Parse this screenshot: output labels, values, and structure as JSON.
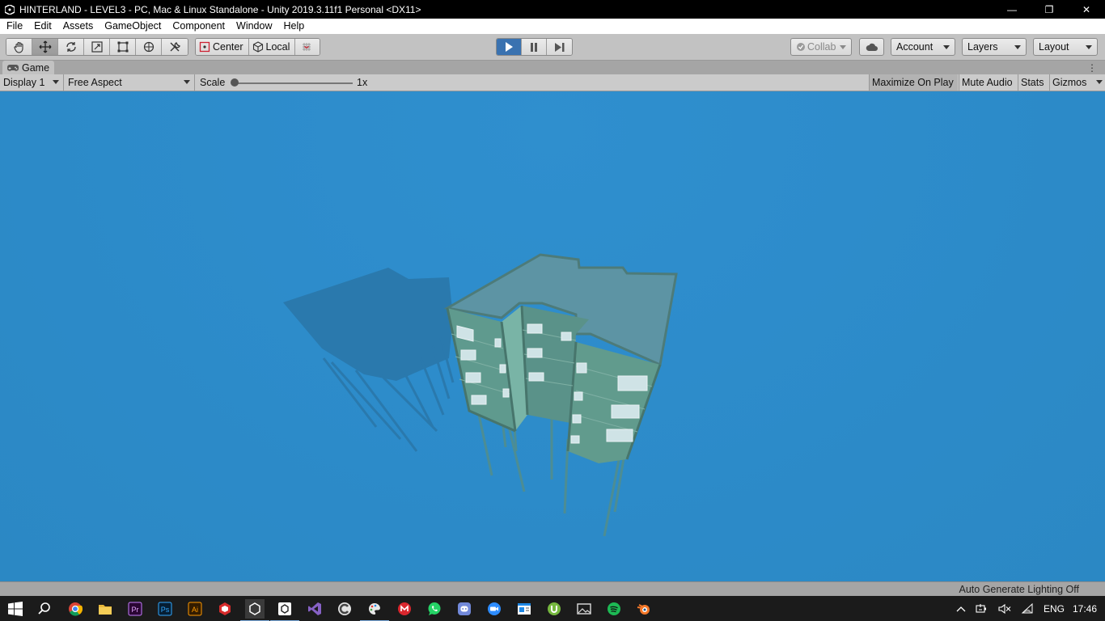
{
  "window": {
    "title": "HINTERLAND - LEVEL3 - PC, Mac & Linux Standalone - Unity 2019.3.11f1 Personal <DX11>",
    "controls": {
      "minimize": "—",
      "maximize": "❐",
      "close": "✕"
    }
  },
  "menu": [
    "File",
    "Edit",
    "Assets",
    "GameObject",
    "Component",
    "Window",
    "Help"
  ],
  "toolbar": {
    "tools": [
      "hand-tool",
      "move-tool",
      "rotate-tool",
      "scale-tool",
      "rect-tool",
      "transform-tool",
      "custom-editor-tool"
    ],
    "active_tool": "move-tool",
    "pivot_mode": "Center",
    "pivot_rotation": "Local",
    "playmode": {
      "playing": true
    },
    "collab_label": "Collab",
    "account_label": "Account",
    "layers_label": "Layers",
    "layout_label": "Layout"
  },
  "game_tab": {
    "label": "Game"
  },
  "game_bar": {
    "display": "Display 1",
    "aspect": "Free Aspect",
    "scale_label": "Scale",
    "scale_value": "1x",
    "scale_fraction": 0.0,
    "maximize_on_play": "Maximize On Play",
    "mute_audio": "Mute Audio",
    "stats": "Stats",
    "gizmos": "Gizmos"
  },
  "status": {
    "text": "Auto Generate Lighting Off"
  },
  "colors": {
    "sky": "#2d8ccb",
    "play_active": "#3a72b0",
    "titlebar": "#000000",
    "taskbar": "#1b1b1b"
  },
  "taskbar": {
    "apps": [
      "start-icon",
      "search-icon",
      "chrome-icon",
      "file-explorer-icon",
      "premiere-icon",
      "photoshop-icon",
      "illustrator-icon",
      "sketchup-icon",
      "unity-icon",
      "unity-hub-icon",
      "visual-studio-icon",
      "ccleaner-icon",
      "paint-icon",
      "mega-icon",
      "whatsapp-icon",
      "discord-icon",
      "zoom-icon",
      "news-icon",
      "utorrent-icon",
      "photos-icon",
      "spotify-icon",
      "blender-icon"
    ],
    "tray": {
      "language": "ENG",
      "time": "17:46"
    }
  }
}
